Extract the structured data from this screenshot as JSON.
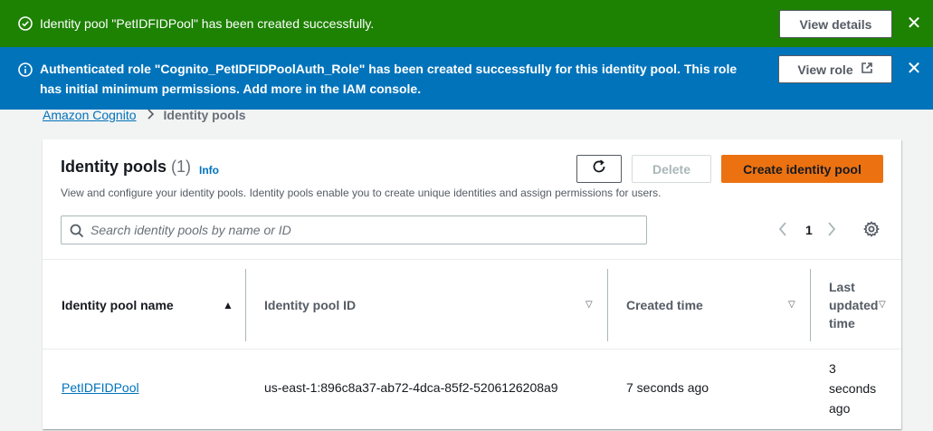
{
  "flash_success": {
    "message": "Identity pool \"PetIDFIDPool\" has been created successfully.",
    "button_label": "View details",
    "color": "#1d8102"
  },
  "flash_info": {
    "message": "Authenticated role \"Cognito_PetIDFIDPoolAuth_Role\" has been created successfully for this identity pool. This role has initial minimum permissions. Add more in the IAM console.",
    "button_label": "View role",
    "color": "#0073bb"
  },
  "breadcrumb": {
    "items": [
      "Amazon Cognito",
      "Identity pools"
    ]
  },
  "panel": {
    "title": "Identity pools",
    "count": "(1)",
    "info_label": "Info",
    "description": "View and configure your identity pools. Identity pools enable you to create unique identities and assign permissions for users.",
    "delete_label": "Delete",
    "create_label": "Create identity pool",
    "accent": "#ec7211"
  },
  "search": {
    "placeholder": "Search identity pools by name or ID",
    "value": ""
  },
  "pagination": {
    "current_page": "1"
  },
  "table": {
    "columns": [
      "Identity pool name",
      "Identity pool ID",
      "Created time",
      "Last updated time"
    ],
    "rows": [
      {
        "name": "PetIDFIDPool",
        "id": "us-east-1:896c8a37-ab72-4dca-85f2-5206126208a9",
        "created": "7 seconds ago",
        "updated": "3 seconds ago"
      }
    ]
  }
}
